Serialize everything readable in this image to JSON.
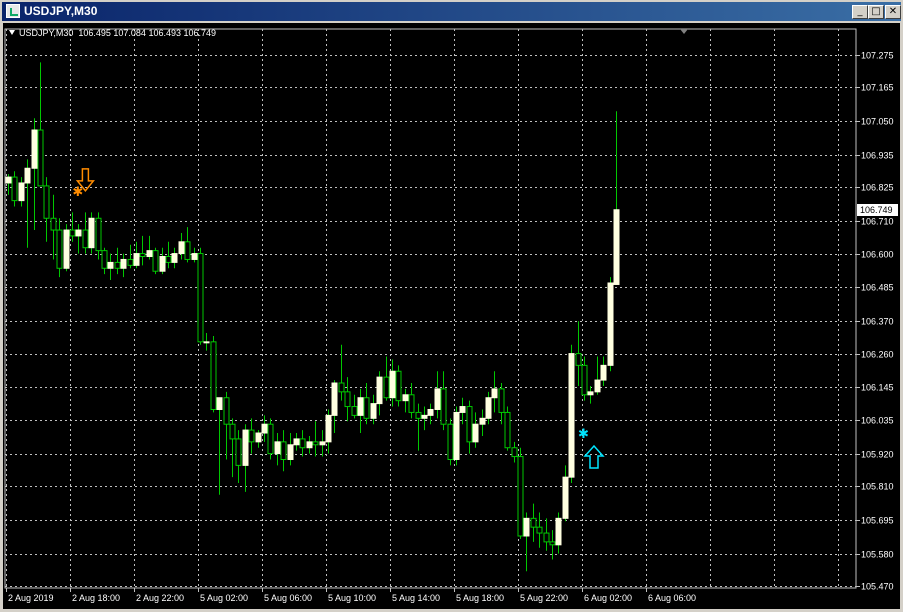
{
  "window": {
    "title": "USDJPY,M30",
    "buttons": {
      "minimize": "_",
      "maximize": "□",
      "close": "✕"
    }
  },
  "chart": {
    "info_label": "USDJPY,M30",
    "info_ohlc": "106.495 107.084 106.493 106.749",
    "background_color": "#000000",
    "grid_color": "#c0c0c0",
    "bull_color": "#ffffe0",
    "bear_color": "#000000",
    "wick_color": "#00c800",
    "current_price_label": "106.749",
    "price_axis": [
      "107.275",
      "107.165",
      "107.050",
      "106.935",
      "106.825",
      "106.710",
      "106.600",
      "106.485",
      "106.370",
      "106.260",
      "106.145",
      "106.035",
      "105.920",
      "105.810",
      "105.695",
      "105.580",
      "105.470"
    ],
    "time_axis": [
      "2 Aug 2019",
      "2 Aug 18:00",
      "2 Aug 22:00",
      "5 Aug 02:00",
      "5 Aug 06:00",
      "5 Aug 10:00",
      "5 Aug 14:00",
      "5 Aug 18:00",
      "5 Aug 22:00",
      "6 Aug 02:00",
      "6 Aug 06:00"
    ]
  },
  "chart_data": {
    "type": "candlestick",
    "symbol": "USDJPY",
    "timeframe": "M30",
    "ylim": [
      105.47,
      107.3
    ],
    "candles": [
      {
        "o": 106.84,
        "h": 106.87,
        "l": 106.8,
        "c": 106.86
      },
      {
        "o": 106.86,
        "h": 106.88,
        "l": 106.76,
        "c": 106.78
      },
      {
        "o": 106.78,
        "h": 106.86,
        "l": 106.76,
        "c": 106.84
      },
      {
        "o": 106.84,
        "h": 106.92,
        "l": 106.62,
        "c": 106.89
      },
      {
        "o": 106.89,
        "h": 107.06,
        "l": 106.68,
        "c": 107.02
      },
      {
        "o": 107.02,
        "h": 107.25,
        "l": 106.86,
        "c": 106.83
      },
      {
        "o": 106.83,
        "h": 106.86,
        "l": 106.64,
        "c": 106.72
      },
      {
        "o": 106.72,
        "h": 106.8,
        "l": 106.58,
        "c": 106.68
      },
      {
        "o": 106.68,
        "h": 106.72,
        "l": 106.52,
        "c": 106.55
      },
      {
        "o": 106.55,
        "h": 106.7,
        "l": 106.54,
        "c": 106.68
      },
      {
        "o": 106.68,
        "h": 106.74,
        "l": 106.64,
        "c": 106.66
      },
      {
        "o": 106.66,
        "h": 106.7,
        "l": 106.6,
        "c": 106.68
      },
      {
        "o": 106.68,
        "h": 106.74,
        "l": 106.6,
        "c": 106.62
      },
      {
        "o": 106.62,
        "h": 106.74,
        "l": 106.6,
        "c": 106.72
      },
      {
        "o": 106.72,
        "h": 106.74,
        "l": 106.58,
        "c": 106.61
      },
      {
        "o": 106.61,
        "h": 106.62,
        "l": 106.53,
        "c": 106.55
      },
      {
        "o": 106.55,
        "h": 106.6,
        "l": 106.51,
        "c": 106.57
      },
      {
        "o": 106.57,
        "h": 106.62,
        "l": 106.53,
        "c": 106.55
      },
      {
        "o": 106.55,
        "h": 106.6,
        "l": 106.52,
        "c": 106.58
      },
      {
        "o": 106.58,
        "h": 106.63,
        "l": 106.55,
        "c": 106.56
      },
      {
        "o": 106.56,
        "h": 106.64,
        "l": 106.55,
        "c": 106.6
      },
      {
        "o": 106.6,
        "h": 106.66,
        "l": 106.56,
        "c": 106.59
      },
      {
        "o": 106.59,
        "h": 106.66,
        "l": 106.58,
        "c": 106.61
      },
      {
        "o": 106.61,
        "h": 106.62,
        "l": 106.53,
        "c": 106.54
      },
      {
        "o": 106.54,
        "h": 106.62,
        "l": 106.53,
        "c": 106.59
      },
      {
        "o": 106.59,
        "h": 106.64,
        "l": 106.55,
        "c": 106.57
      },
      {
        "o": 106.57,
        "h": 106.62,
        "l": 106.55,
        "c": 106.6
      },
      {
        "o": 106.6,
        "h": 106.67,
        "l": 106.58,
        "c": 106.64
      },
      {
        "o": 106.64,
        "h": 106.69,
        "l": 106.57,
        "c": 106.58
      },
      {
        "o": 106.58,
        "h": 106.62,
        "l": 106.57,
        "c": 106.6
      },
      {
        "o": 106.6,
        "h": 106.62,
        "l": 106.29,
        "c": 106.3
      },
      {
        "o": 106.3,
        "h": 106.33,
        "l": 106.27,
        "c": 106.3
      },
      {
        "o": 106.3,
        "h": 106.32,
        "l": 106.06,
        "c": 106.07
      },
      {
        "o": 106.07,
        "h": 106.1,
        "l": 105.78,
        "c": 106.11
      },
      {
        "o": 106.11,
        "h": 106.13,
        "l": 105.9,
        "c": 106.02
      },
      {
        "o": 106.02,
        "h": 106.04,
        "l": 105.84,
        "c": 105.97
      },
      {
        "o": 105.97,
        "h": 106.0,
        "l": 105.82,
        "c": 105.88
      },
      {
        "o": 105.88,
        "h": 106.02,
        "l": 105.79,
        "c": 106.0
      },
      {
        "o": 106.0,
        "h": 106.04,
        "l": 105.92,
        "c": 105.96
      },
      {
        "o": 105.96,
        "h": 106.0,
        "l": 105.94,
        "c": 105.99
      },
      {
        "o": 105.99,
        "h": 106.05,
        "l": 105.96,
        "c": 106.02
      },
      {
        "o": 106.02,
        "h": 106.04,
        "l": 105.9,
        "c": 105.92
      },
      {
        "o": 105.92,
        "h": 105.99,
        "l": 105.88,
        "c": 105.96
      },
      {
        "o": 105.96,
        "h": 106.0,
        "l": 105.86,
        "c": 105.9
      },
      {
        "o": 105.9,
        "h": 105.99,
        "l": 105.88,
        "c": 105.95
      },
      {
        "o": 105.95,
        "h": 105.99,
        "l": 105.93,
        "c": 105.97
      },
      {
        "o": 105.97,
        "h": 106.0,
        "l": 105.91,
        "c": 105.94
      },
      {
        "o": 105.94,
        "h": 105.98,
        "l": 105.92,
        "c": 105.96
      },
      {
        "o": 105.96,
        "h": 106.03,
        "l": 105.91,
        "c": 105.95
      },
      {
        "o": 105.95,
        "h": 106.0,
        "l": 105.91,
        "c": 105.96
      },
      {
        "o": 105.96,
        "h": 106.07,
        "l": 105.92,
        "c": 106.05
      },
      {
        "o": 106.05,
        "h": 106.17,
        "l": 105.99,
        "c": 106.16
      },
      {
        "o": 106.16,
        "h": 106.29,
        "l": 106.1,
        "c": 106.13
      },
      {
        "o": 106.13,
        "h": 106.18,
        "l": 106.03,
        "c": 106.08
      },
      {
        "o": 106.08,
        "h": 106.12,
        "l": 106.04,
        "c": 106.05
      },
      {
        "o": 106.05,
        "h": 106.14,
        "l": 105.99,
        "c": 106.11
      },
      {
        "o": 106.11,
        "h": 106.16,
        "l": 106.02,
        "c": 106.04
      },
      {
        "o": 106.04,
        "h": 106.12,
        "l": 106.02,
        "c": 106.09
      },
      {
        "o": 106.09,
        "h": 106.2,
        "l": 106.05,
        "c": 106.18
      },
      {
        "o": 106.18,
        "h": 106.25,
        "l": 106.1,
        "c": 106.11
      },
      {
        "o": 106.11,
        "h": 106.24,
        "l": 106.08,
        "c": 106.2
      },
      {
        "o": 106.2,
        "h": 106.22,
        "l": 106.08,
        "c": 106.1
      },
      {
        "o": 106.1,
        "h": 106.14,
        "l": 106.06,
        "c": 106.12
      },
      {
        "o": 106.12,
        "h": 106.16,
        "l": 106.04,
        "c": 106.06
      },
      {
        "o": 106.06,
        "h": 106.09,
        "l": 105.93,
        "c": 106.04
      },
      {
        "o": 106.04,
        "h": 106.08,
        "l": 106.0,
        "c": 106.05
      },
      {
        "o": 106.05,
        "h": 106.09,
        "l": 106.02,
        "c": 106.07
      },
      {
        "o": 106.07,
        "h": 106.2,
        "l": 106.04,
        "c": 106.14
      },
      {
        "o": 106.14,
        "h": 106.2,
        "l": 106.0,
        "c": 106.02
      },
      {
        "o": 106.02,
        "h": 106.04,
        "l": 105.88,
        "c": 105.9
      },
      {
        "o": 105.9,
        "h": 106.08,
        "l": 105.88,
        "c": 106.06
      },
      {
        "o": 106.06,
        "h": 106.11,
        "l": 106.02,
        "c": 106.08
      },
      {
        "o": 106.08,
        "h": 106.1,
        "l": 105.92,
        "c": 105.96
      },
      {
        "o": 105.96,
        "h": 106.06,
        "l": 105.94,
        "c": 106.02
      },
      {
        "o": 106.02,
        "h": 106.07,
        "l": 105.98,
        "c": 106.04
      },
      {
        "o": 106.04,
        "h": 106.13,
        "l": 106.02,
        "c": 106.11
      },
      {
        "o": 106.11,
        "h": 106.2,
        "l": 106.06,
        "c": 106.14
      },
      {
        "o": 106.14,
        "h": 106.16,
        "l": 106.02,
        "c": 106.06
      },
      {
        "o": 106.06,
        "h": 106.08,
        "l": 105.93,
        "c": 105.94
      },
      {
        "o": 105.94,
        "h": 105.96,
        "l": 105.89,
        "c": 105.91
      },
      {
        "o": 105.91,
        "h": 105.94,
        "l": 105.63,
        "c": 105.64
      },
      {
        "o": 105.64,
        "h": 105.72,
        "l": 105.52,
        "c": 105.7
      },
      {
        "o": 105.7,
        "h": 105.75,
        "l": 105.62,
        "c": 105.67
      },
      {
        "o": 105.67,
        "h": 105.72,
        "l": 105.6,
        "c": 105.65
      },
      {
        "o": 105.65,
        "h": 105.7,
        "l": 105.59,
        "c": 105.62
      },
      {
        "o": 105.62,
        "h": 105.66,
        "l": 105.56,
        "c": 105.61
      },
      {
        "o": 105.61,
        "h": 105.72,
        "l": 105.58,
        "c": 105.7
      },
      {
        "o": 105.7,
        "h": 105.88,
        "l": 105.69,
        "c": 105.84
      },
      {
        "o": 105.84,
        "h": 106.29,
        "l": 105.82,
        "c": 106.26
      },
      {
        "o": 106.26,
        "h": 106.37,
        "l": 106.15,
        "c": 106.22
      },
      {
        "o": 106.22,
        "h": 106.25,
        "l": 106.1,
        "c": 106.12
      },
      {
        "o": 106.12,
        "h": 106.15,
        "l": 106.09,
        "c": 106.13
      },
      {
        "o": 106.13,
        "h": 106.25,
        "l": 106.12,
        "c": 106.17
      },
      {
        "o": 106.17,
        "h": 106.25,
        "l": 106.15,
        "c": 106.22
      },
      {
        "o": 106.22,
        "h": 106.52,
        "l": 106.2,
        "c": 106.5
      },
      {
        "o": 106.495,
        "h": 107.084,
        "l": 106.493,
        "c": 106.749
      }
    ],
    "markers": [
      {
        "type": "sell-arrow",
        "index": 11,
        "price": 106.82,
        "color": "#ff8c00"
      },
      {
        "type": "buy-arrow",
        "index": 90,
        "price": 105.98,
        "color": "#00e5ff"
      }
    ]
  }
}
